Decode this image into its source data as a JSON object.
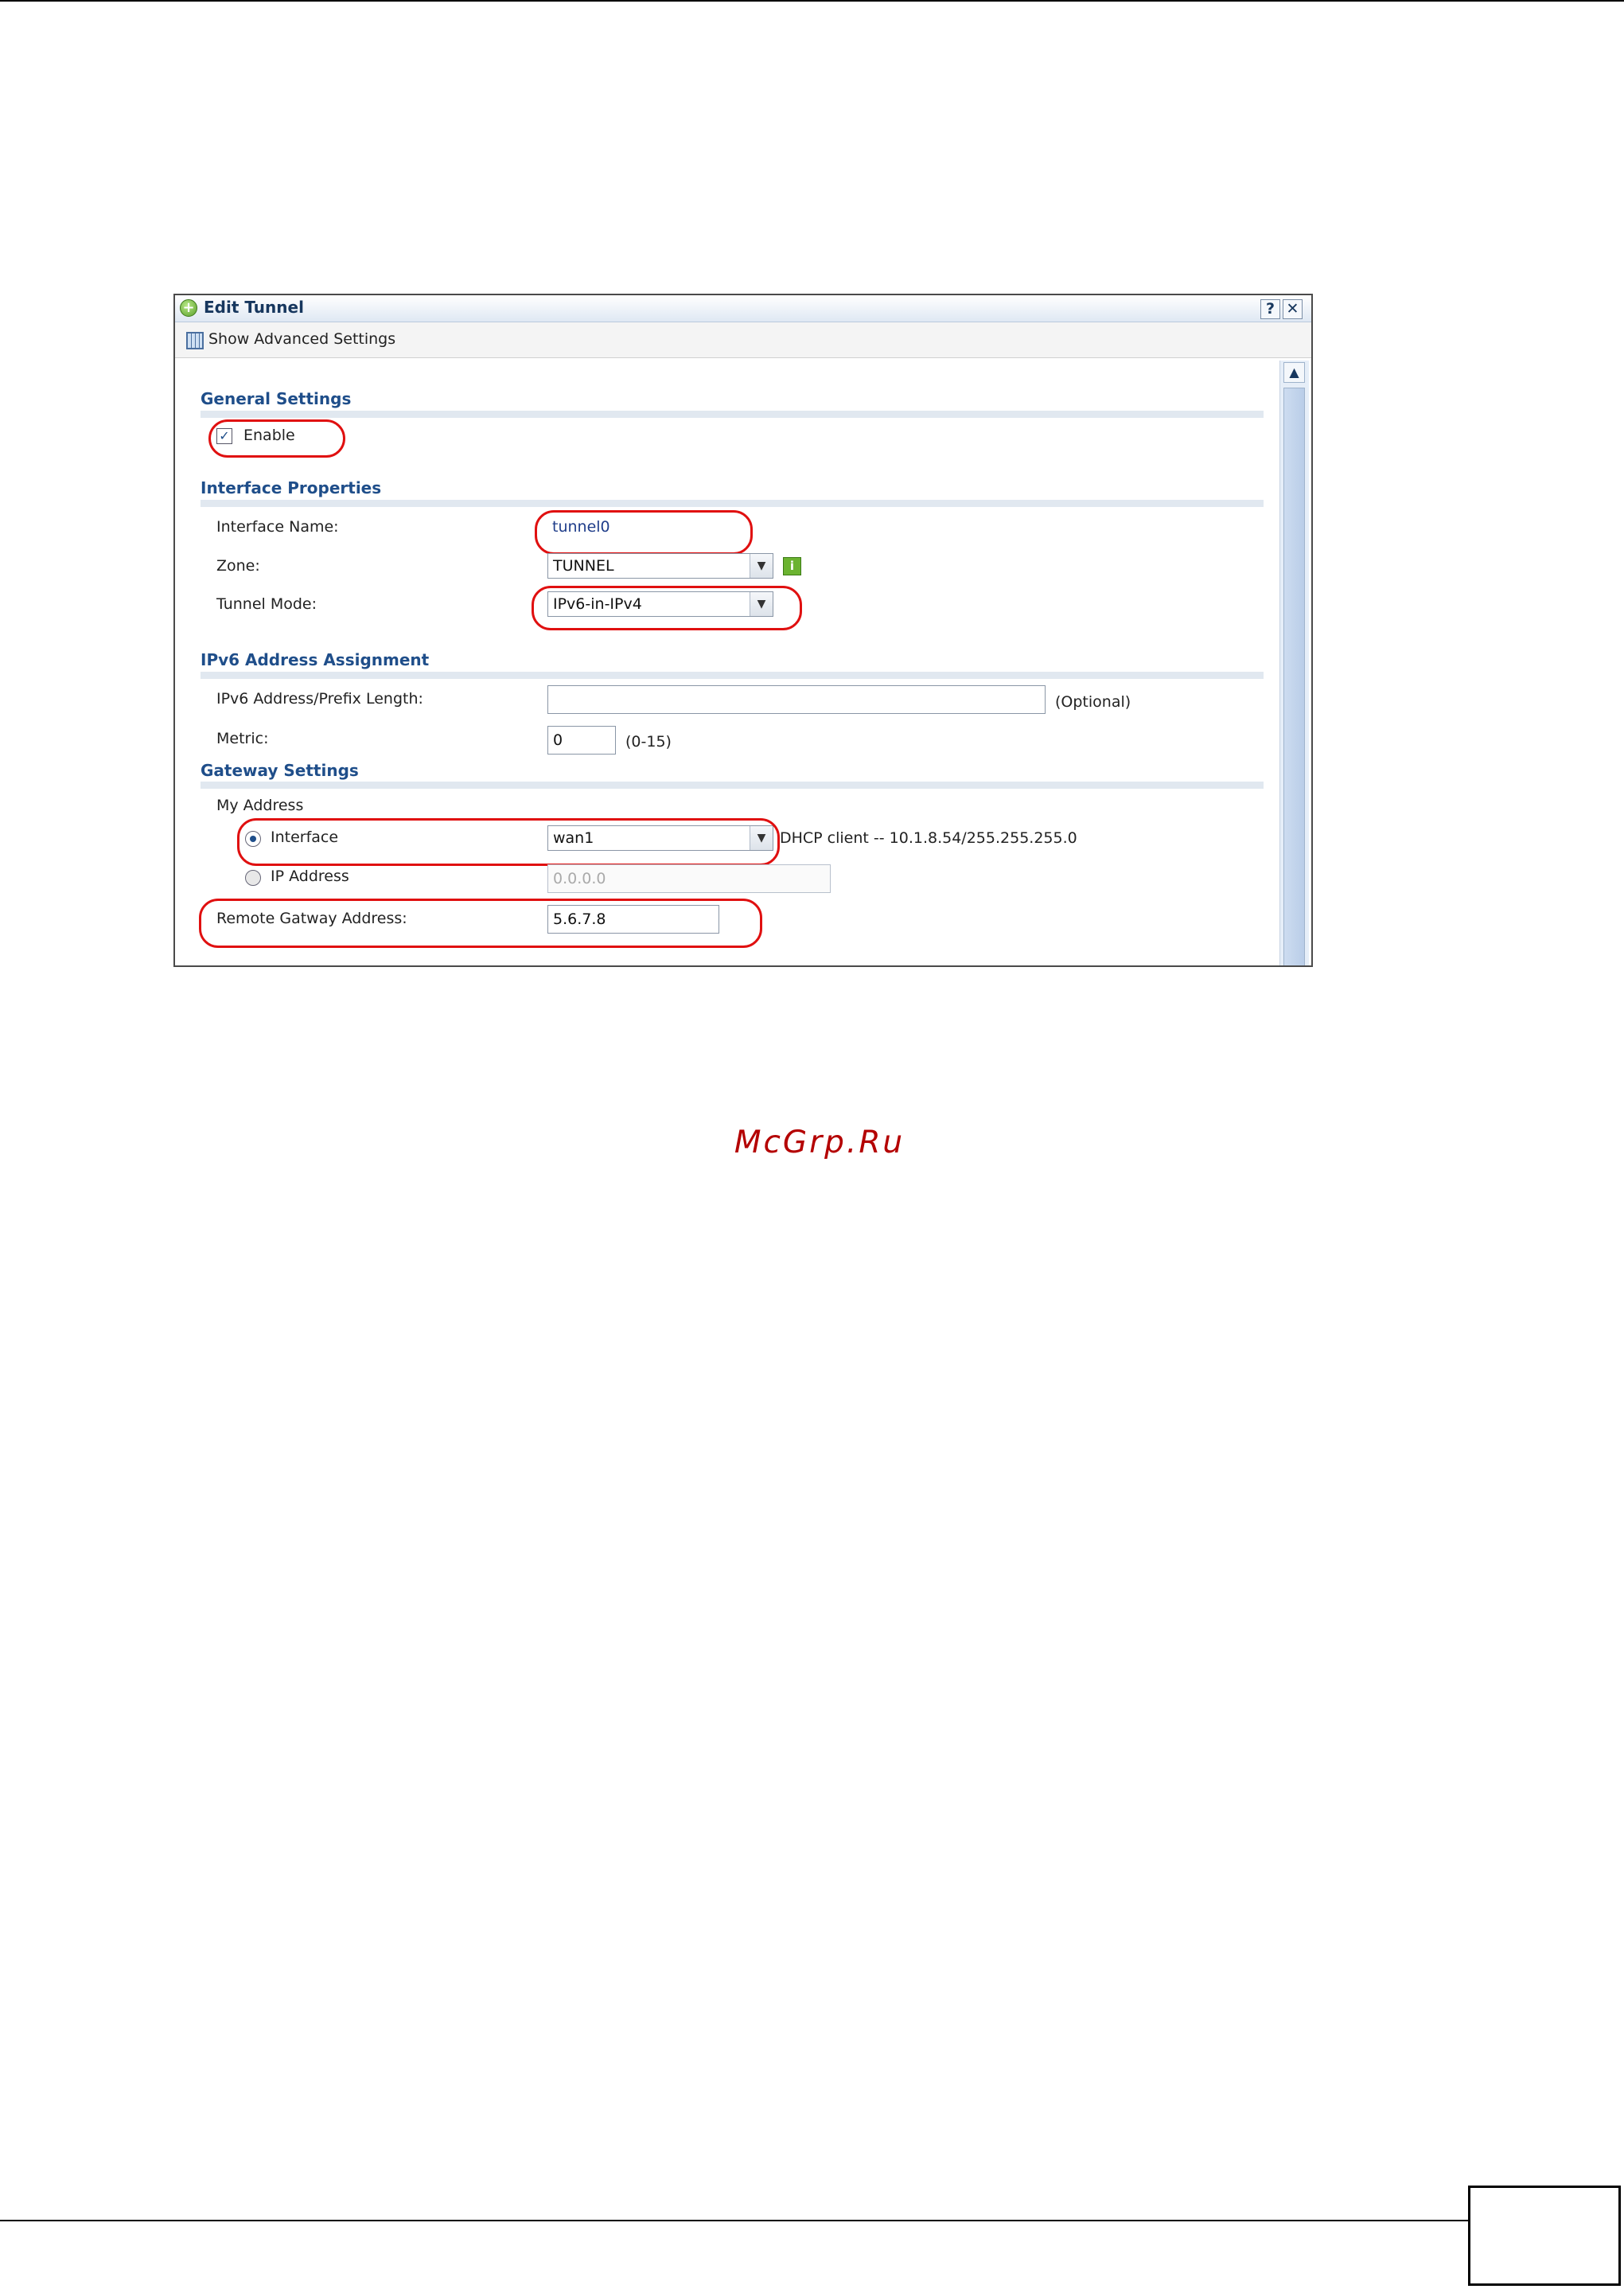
{
  "dialog": {
    "title": "Edit Tunnel",
    "help_symbol": "?",
    "close_symbol": "✕"
  },
  "toolbar": {
    "advanced_label": "Show Advanced Settings"
  },
  "sections": {
    "general": "General Settings",
    "interface": "Interface Properties",
    "ipv6": "IPv6 Address Assignment",
    "gateway": "Gateway Settings"
  },
  "general": {
    "enable_label": "Enable",
    "enable_checked": true
  },
  "interface": {
    "name_label": "Interface Name:",
    "name_value": "tunnel0",
    "zone_label": "Zone:",
    "zone_value": "TUNNEL",
    "mode_label": "Tunnel Mode:",
    "mode_value": "IPv6-in-IPv4"
  },
  "ipv6": {
    "prefix_label": "IPv6 Address/Prefix Length:",
    "prefix_value": "",
    "prefix_hint": "(Optional)",
    "metric_label": "Metric:",
    "metric_value": "0",
    "metric_hint": "(0-15)"
  },
  "gateway": {
    "my_address_label": "My Address",
    "interface_option": "Interface",
    "interface_value": "wan1",
    "interface_info": "DHCP client -- 10.1.8.54/255.255.255.0",
    "ip_option": "IP Address",
    "ip_value": "0.0.0.0",
    "remote_label": "Remote Gatway Address:",
    "remote_value": "5.6.7.8"
  },
  "watermark": "McGrp.Ru",
  "colors": {
    "highlight": "#e01010",
    "section_title": "#1f4e8a",
    "watermark": "#b40000"
  }
}
